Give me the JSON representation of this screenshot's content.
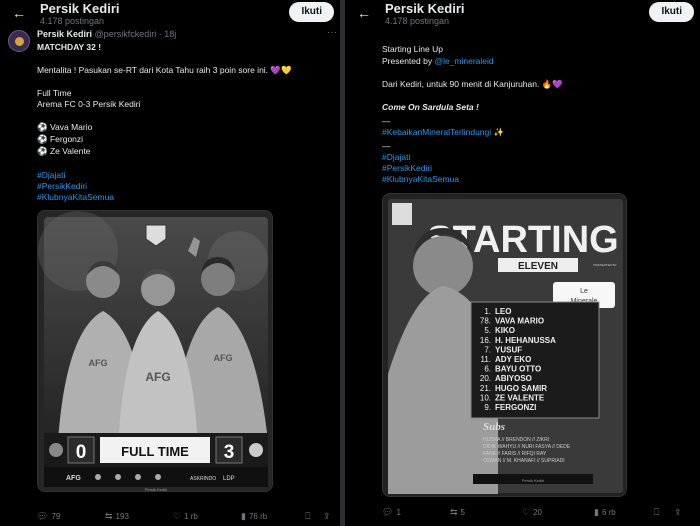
{
  "account": {
    "name": "Persik Kediri",
    "post_count": "4.178 postingan",
    "follow_label": "Ikuti",
    "back_icon": "arrow-left-icon"
  },
  "left_post": {
    "name": "Persik Kediri",
    "handle": "@persikfckediri · 18j",
    "lines": {
      "heading": "MATCHDAY 32 !",
      "text1": "Mentalita ! Pasukan se-RT dari Kota Tahu raih 3 poin sore ini. 💜💛",
      "text2": "Full Time",
      "text3": "Arema FC 0-3 Persik Kediri",
      "scorer1": "Vava Mario",
      "scorer2": "Fergonzi",
      "scorer3": "Ze Valente",
      "tag1": "#Djajati",
      "tag2": "#PersikKediri",
      "tag3": "#KlubnyaKitaSemua"
    },
    "image": {
      "score_home": "0",
      "score_away": "3",
      "full_time": "FULL TIME",
      "shirt_text": "AFG",
      "sponsor1": "AFG",
      "sponsor2": "ASKRINDO",
      "sponsor3": "LDP",
      "footer_handle": "Persik Kediri"
    },
    "actions": {
      "replies": "79",
      "reposts": "193",
      "likes": "1 rb",
      "views": "76 rb"
    }
  },
  "right_post": {
    "lines": {
      "l1": "Starting Line Up",
      "l2": "Presented by ",
      "l2_link": "@le_mineraleid",
      "l3": "Dari Kediri, untuk 90 menit di Kanjuruhan. 🔥💜",
      "l4": "Come On Sardula Seta !",
      "dash1": "—",
      "l5": "#KebaikanMineralTerlindungi ✨",
      "dash2": "—",
      "tag1": "#Djajati",
      "tag2": "#PersikKediri",
      "tag3": "#KlubnyaKitaSemua"
    },
    "image": {
      "starting": "STARTING",
      "eleven": "ELEVEN",
      "presented_by": "PRESENTED BY",
      "brand_line1": "Le",
      "brand_line2": "Minerale",
      "players": [
        {
          "num": "1.",
          "name": "LEO"
        },
        {
          "num": "78.",
          "name": "VAVA MARIO"
        },
        {
          "num": "5.",
          "name": "KIKO"
        },
        {
          "num": "16.",
          "name": "H. HEHANUSSA"
        },
        {
          "num": "7.",
          "name": "YUSUF"
        },
        {
          "num": "11.",
          "name": "ADY EKO"
        },
        {
          "num": "6.",
          "name": "BAYU OTTO"
        },
        {
          "num": "20.",
          "name": "ABIYOSO"
        },
        {
          "num": "21.",
          "name": "HUGO SAMIR"
        },
        {
          "num": "10.",
          "name": "ZE VALENTE"
        },
        {
          "num": "9.",
          "name": "FERGONZI"
        }
      ],
      "subs_title": "Subs",
      "subs_line1": "HUSNA // BRENDON // ZIKRI",
      "subs_line2": "DIDIK WAHYU // NURI FASYA // DEDE",
      "subs_line3": "FANE // FARIS // RIFQI RAY",
      "subs_line4": "OSMAN // M. KHANAFI // SUPRIADI",
      "footer_handle": "Persik Kediri"
    },
    "actions": {
      "replies": "1",
      "reposts": "5",
      "likes": "20",
      "views": "6 rb"
    }
  },
  "colors": {
    "background": "#000000",
    "text": "#e7e9ea",
    "muted": "#71767b",
    "link": "#1d9bf0",
    "button_bg": "#eff3f4"
  }
}
